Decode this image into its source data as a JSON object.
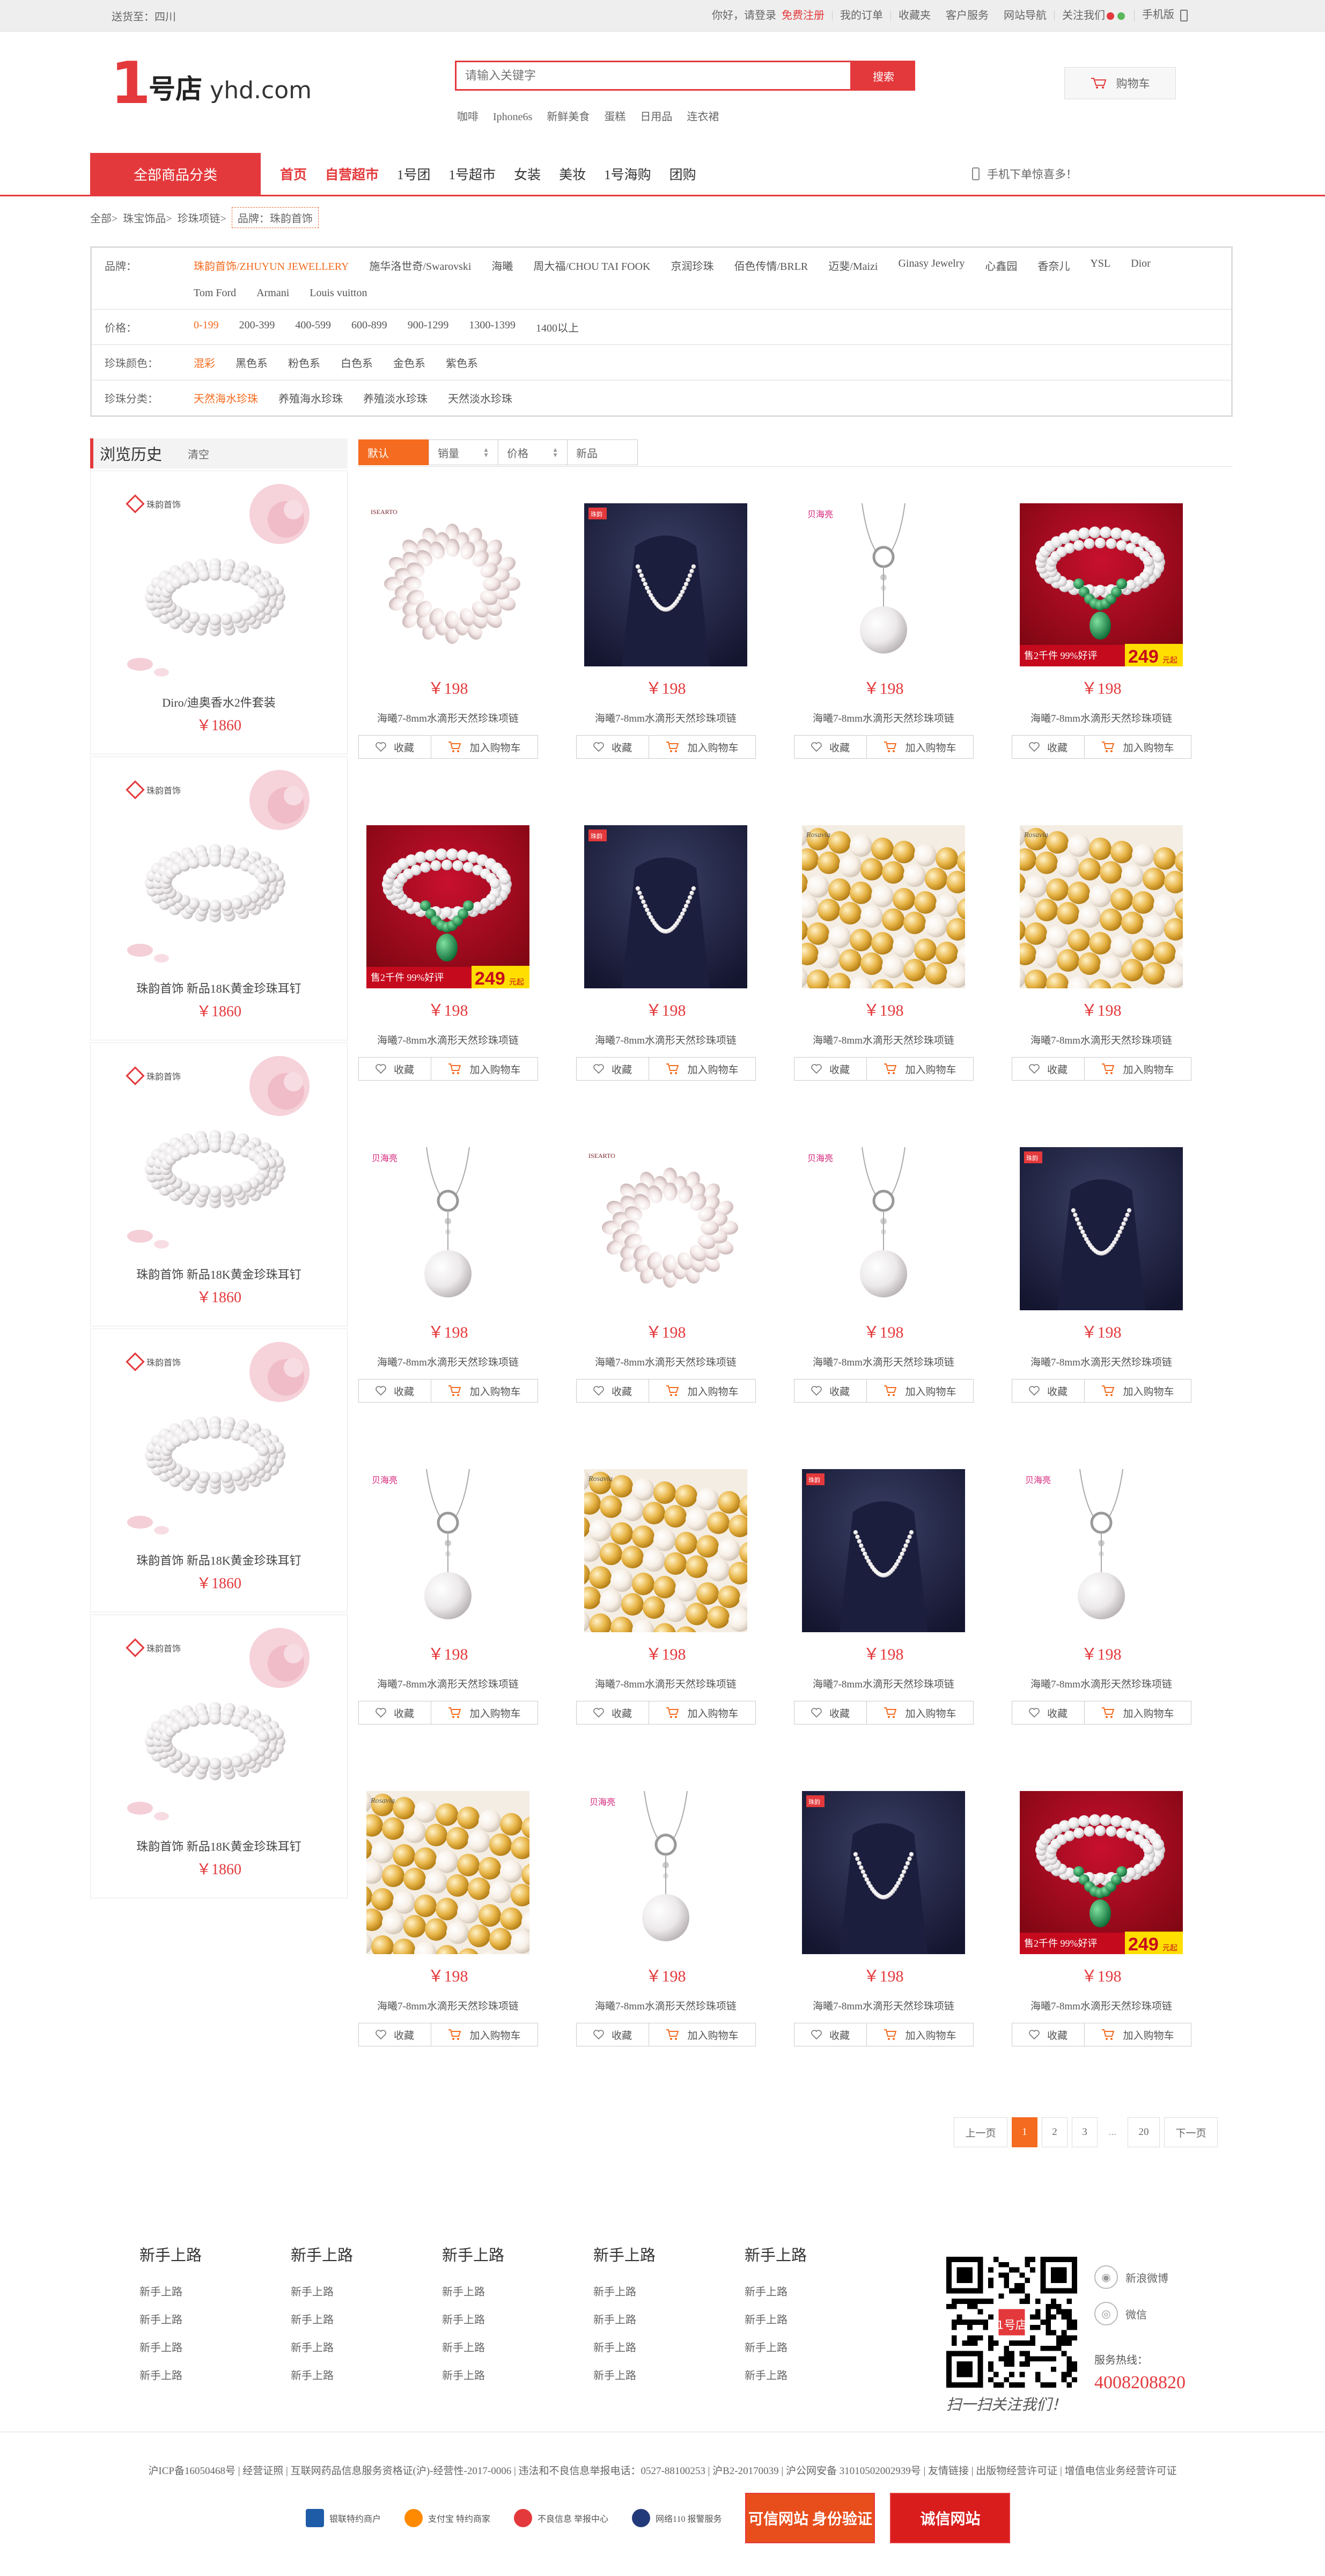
{
  "topbar": {
    "ship_to": "送货至：四川",
    "greeting": "你好，请登录",
    "register": "免费注册",
    "links": [
      "我的订单",
      "收藏夹",
      "客户服务",
      "网站导航"
    ],
    "follow": "关注我们",
    "mobile": "手机版"
  },
  "logo": {
    "number": "1",
    "cn": "号店",
    "domain": "yhd.com"
  },
  "search": {
    "placeholder": "请输入关键字",
    "button": "搜索",
    "hot": [
      "咖啡",
      "Iphone6s",
      "新鲜美食",
      "蛋糕",
      "日用品",
      "连衣裙"
    ]
  },
  "cart": {
    "label": "购物车"
  },
  "nav": {
    "all_categories": "全部商品分类",
    "links": [
      "首页",
      "自营超市",
      "1号团",
      "1号超市",
      "女装",
      "美妆",
      "1号海购",
      "团购"
    ],
    "mobile_promo": "手机下单惊喜多！"
  },
  "breadcrumb": {
    "items": [
      "全部>",
      "珠宝饰品>",
      "珍珠项链>"
    ],
    "current": "品牌：珠韵首饰"
  },
  "filters": [
    {
      "label": "品牌：",
      "values": [
        "珠韵首饰/ZHUYUN JEWELLERY",
        "施华洛世奇/Swarovski",
        "海曦",
        "周大福/CHOU TAI FOOK",
        "京润珍珠",
        "佰色传情/BRLR",
        "迈斐/Maizi",
        "Ginasy Jewelry",
        "心鑫园",
        "香奈儿",
        "YSL",
        "Dior",
        "Tom Ford",
        "Armani",
        "Louis vuitton"
      ]
    },
    {
      "label": "价格：",
      "values": [
        "0-199",
        "200-399",
        "400-599",
        "600-899",
        "900-1299",
        "1300-1399",
        "1400以上"
      ]
    },
    {
      "label": "珍珠颜色：",
      "values": [
        "混彩",
        "黑色系",
        "粉色系",
        "白色系",
        "金色系",
        "紫色系"
      ]
    },
    {
      "label": "珍珠分类：",
      "values": [
        "天然海水珍珠",
        "养殖海水珍珠",
        "养殖淡水珍珠",
        "天然淡水珍珠"
      ]
    }
  ],
  "history": {
    "title": "浏览历史",
    "clear": "清空",
    "items": [
      {
        "name": "Diro/迪奥香水2件套装",
        "price": "￥1860"
      },
      {
        "name": "珠韵首饰 新品18K黄金珍珠耳钉",
        "price": "￥1860"
      },
      {
        "name": "珠韵首饰 新品18K黄金珍珠耳钉",
        "price": "￥1860"
      },
      {
        "name": "珠韵首饰 新品18K黄金珍珠耳钉",
        "price": "￥1860"
      },
      {
        "name": "珠韵首饰 新品18K黄金珍珠耳钉",
        "price": "￥1860"
      }
    ]
  },
  "sort": {
    "default": "默认",
    "sales": "销量",
    "price": "价格",
    "new": "新品"
  },
  "product_defaults": {
    "price": "￥198",
    "title": "海曦7-8mm水滴形天然珍珠项链",
    "fav": "收藏",
    "add_cart": "加入购物车"
  },
  "products": [
    {
      "img": "oval"
    },
    {
      "img": "dark"
    },
    {
      "img": "pendant"
    },
    {
      "img": "red"
    },
    {
      "img": "red"
    },
    {
      "img": "dark"
    },
    {
      "img": "gold"
    },
    {
      "img": "gold"
    },
    {
      "img": "pendant"
    },
    {
      "img": "oval"
    },
    {
      "img": "pendant"
    },
    {
      "img": "dark"
    },
    {
      "img": "pendant"
    },
    {
      "img": "gold"
    },
    {
      "img": "dark"
    },
    {
      "img": "pendant"
    },
    {
      "img": "gold"
    },
    {
      "img": "pendant"
    },
    {
      "img": "dark"
    },
    {
      "img": "red"
    }
  ],
  "image_text": {
    "red_promo": "售2千件 99%好评",
    "red_price": "249",
    "red_unit": "元起",
    "brand_tag": "珠韵首饰",
    "pendant_tag": "贝海亮",
    "gold_tag": "Rosavia"
  },
  "pager": {
    "prev": "上一页",
    "pages": [
      "1",
      "2",
      "3"
    ],
    "ellipsis": "...",
    "last": "20",
    "next": "下一页"
  },
  "footer": {
    "columns": [
      {
        "title": "新手上路",
        "links": [
          "新手上路",
          "新手上路",
          "新手上路",
          "新手上路"
        ]
      },
      {
        "title": "新手上路",
        "links": [
          "新手上路",
          "新手上路",
          "新手上路",
          "新手上路"
        ]
      },
      {
        "title": "新手上路",
        "links": [
          "新手上路",
          "新手上路",
          "新手上路",
          "新手上路"
        ]
      },
      {
        "title": "新手上路",
        "links": [
          "新手上路",
          "新手上路",
          "新手上路",
          "新手上路"
        ]
      },
      {
        "title": "新手上路",
        "links": [
          "新手上路",
          "新手上路",
          "新手上路",
          "新手上路"
        ]
      }
    ],
    "qr_caption": "扫一扫关注我们！",
    "weibo": "新浪微博",
    "wechat": "微信",
    "hotline_label": "服务热线：",
    "hotline": "4008208820",
    "qr_center": "1号店",
    "icp": "沪ICP备16050468号 | 经营证照 | 互联网药品信息服务资格证(沪)-经营性-2017-0006 | 违法和不良信息举报电话：0527-88100253 | 沪B2-20170039 | 沪公网安备 31010502002939号 | 友情链接 | 出版物经营许可证 | 增值电信业务经营许可证",
    "badges": [
      "银联特约商户",
      "支付宝 特约商家",
      "不良信息 举报中心",
      "网络110 报警服务",
      "可信网站 身份验证",
      "诚信网站"
    ]
  }
}
